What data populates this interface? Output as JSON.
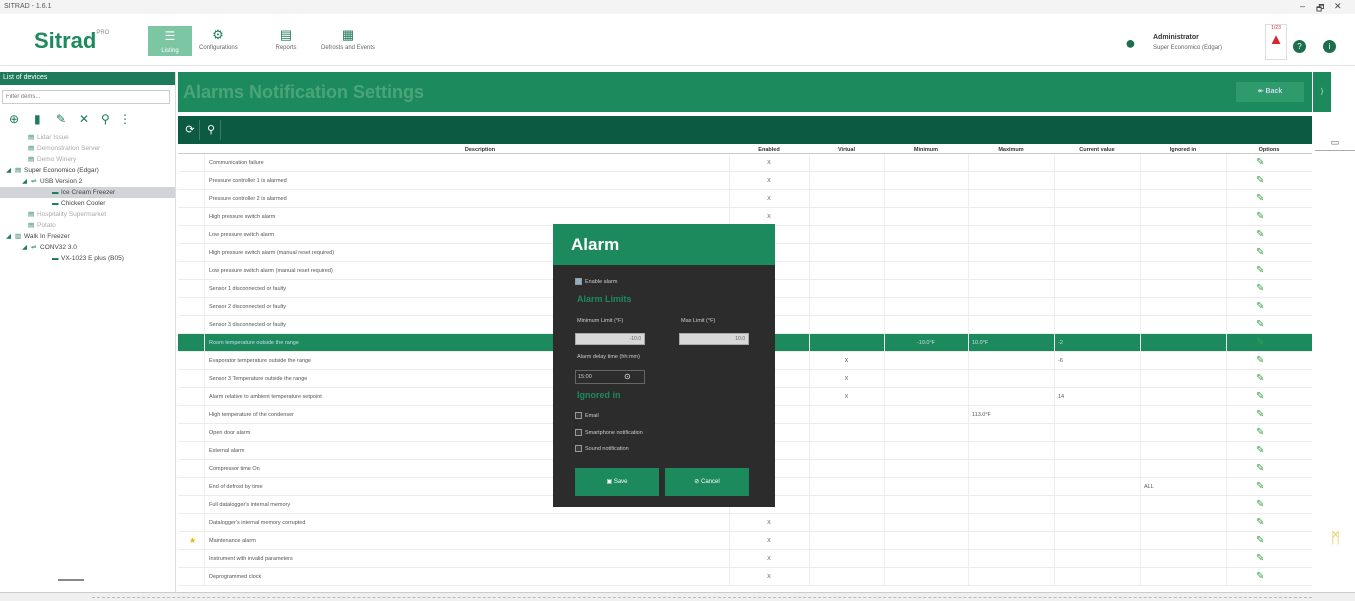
{
  "window": {
    "title": "SITRAD - 1.6.1",
    "minimize": "–",
    "maximize": "🗗",
    "close": "✕"
  },
  "header": {
    "logo": "Sitrad",
    "logo_badge": "PRO",
    "menu_label": "Listing",
    "nav": [
      "Configurations",
      "Reports",
      "Defrosts and Events"
    ],
    "user": {
      "name": "Administrator",
      "subtitle": "Super Economico (Edgar)"
    },
    "alarm_count": "1/23"
  },
  "sidebar": {
    "title": "List of devices",
    "filter_placeholder": "Filter items...",
    "tree": [
      "Lidar Issue",
      "Demonstration Server",
      "Demo Winery",
      "Super Economico (Edgar)",
      "USB Version 2",
      "Ice Cream Freezer",
      "Chicken Cooler",
      "Hospitality Supermarket",
      "Potato",
      "Walk In Freezer",
      "CONV32 3.0",
      "VX-1023 E plus (B05)"
    ]
  },
  "main": {
    "title": "Alarms Notification Settings",
    "back_label": "Back"
  },
  "table": {
    "headers": [
      "Description",
      "Enabled",
      "Virtual",
      "Minimum",
      "Maximum",
      "Current value",
      "Ignored in",
      "Options"
    ],
    "rows": [
      {
        "description": "Communication failure",
        "enabled": "X",
        "virtual": "",
        "minimum": "",
        "maximum": "",
        "current": "",
        "ignored": ""
      },
      {
        "description": "Pressure controller 1 is alarmed",
        "enabled": "X",
        "virtual": "",
        "minimum": "",
        "maximum": "",
        "current": "",
        "ignored": ""
      },
      {
        "description": "Pressure controller 2 is alarmed",
        "enabled": "X",
        "virtual": "",
        "minimum": "",
        "maximum": "",
        "current": "",
        "ignored": ""
      },
      {
        "description": "High pressure switch alarm",
        "enabled": "X",
        "virtual": "",
        "minimum": "",
        "maximum": "",
        "current": "",
        "ignored": ""
      },
      {
        "description": "Low pressure switch alarm",
        "enabled": "",
        "virtual": "",
        "minimum": "",
        "maximum": "",
        "current": "",
        "ignored": ""
      },
      {
        "description": "High pressure switch alarm (manual reset required)",
        "enabled": "",
        "virtual": "",
        "minimum": "",
        "maximum": "",
        "current": "",
        "ignored": ""
      },
      {
        "description": "Low pressure switch alarm (manual reset required)",
        "enabled": "",
        "virtual": "",
        "minimum": "",
        "maximum": "",
        "current": "",
        "ignored": ""
      },
      {
        "description": "Sensor 1 disconnected or faulty",
        "enabled": "",
        "virtual": "",
        "minimum": "",
        "maximum": "",
        "current": "",
        "ignored": ""
      },
      {
        "description": "Sensor 2 disconnected or faulty",
        "enabled": "",
        "virtual": "",
        "minimum": "",
        "maximum": "",
        "current": "",
        "ignored": ""
      },
      {
        "description": "Sensor 3 disconnected or faulty",
        "enabled": "",
        "virtual": "",
        "minimum": "",
        "maximum": "",
        "current": "",
        "ignored": ""
      },
      {
        "description": "Room temperature outside the range",
        "enabled": "",
        "virtual": "",
        "minimum": "-10.0°F",
        "maximum": "10.0°F",
        "current": "-2",
        "ignored": "",
        "selected": true
      },
      {
        "description": "Evaporator temperature outside the range",
        "enabled": "",
        "virtual": "X",
        "minimum": "",
        "maximum": "",
        "current": "-6",
        "ignored": ""
      },
      {
        "description": "Sensor 3 Temperature outside the range",
        "enabled": "",
        "virtual": "X",
        "minimum": "",
        "maximum": "",
        "current": "",
        "ignored": ""
      },
      {
        "description": "Alarm relative to ambient temperature setpoint",
        "enabled": "",
        "virtual": "X",
        "minimum": "",
        "maximum": "",
        "current": "14",
        "ignored": ""
      },
      {
        "description": "High temperature of the condenser",
        "enabled": "",
        "virtual": "",
        "minimum": "",
        "maximum": "113.0°F",
        "current": "",
        "ignored": ""
      },
      {
        "description": "Open door alarm",
        "enabled": "",
        "virtual": "",
        "minimum": "",
        "maximum": "",
        "current": "",
        "ignored": ""
      },
      {
        "description": "External alarm",
        "enabled": "",
        "virtual": "",
        "minimum": "",
        "maximum": "",
        "current": "",
        "ignored": ""
      },
      {
        "description": "Compressor time On",
        "enabled": "",
        "virtual": "",
        "minimum": "",
        "maximum": "",
        "current": "",
        "ignored": ""
      },
      {
        "description": "End of defrost by time",
        "enabled": "",
        "virtual": "",
        "minimum": "",
        "maximum": "",
        "current": "",
        "ignored": "ALL"
      },
      {
        "description": "Full datalogger's internal memory",
        "enabled": "",
        "virtual": "",
        "minimum": "",
        "maximum": "",
        "current": "",
        "ignored": ""
      },
      {
        "description": "Datalogger's internal memory corrupted",
        "enabled": "X",
        "virtual": "",
        "minimum": "",
        "maximum": "",
        "current": "",
        "ignored": ""
      },
      {
        "description": "Maintenance alarm",
        "enabled": "X",
        "virtual": "",
        "minimum": "",
        "maximum": "",
        "current": "",
        "ignored": "",
        "warning": true
      },
      {
        "description": "Instrument with invalid parameters",
        "enabled": "X",
        "virtual": "",
        "minimum": "",
        "maximum": "",
        "current": "",
        "ignored": ""
      },
      {
        "description": "Deprogrammed clock",
        "enabled": "X",
        "virtual": "",
        "minimum": "",
        "maximum": "",
        "current": "",
        "ignored": ""
      }
    ]
  },
  "modal": {
    "title": "Alarm",
    "enable_label": "Enable alarm",
    "limits_heading": "Alarm Limits",
    "min_label": "Minimum Limit (°F)",
    "max_label": "Max Limit (°F)",
    "min_value": "-10.0",
    "max_value": "10.0",
    "delay_label": "Alarm delay time (hh:mm)",
    "delay_value": "15:00",
    "ignored_heading": "Ignored in",
    "options": [
      "Email",
      "Smartphone notification",
      "Sound notification"
    ],
    "save_label": "Save",
    "cancel_label": "Cancel"
  },
  "colors": {
    "accent": "#1d8a5e",
    "toolbar": "#0c5a41",
    "modal_bg": "#2c2c2c",
    "alarm": "#d8262b"
  }
}
